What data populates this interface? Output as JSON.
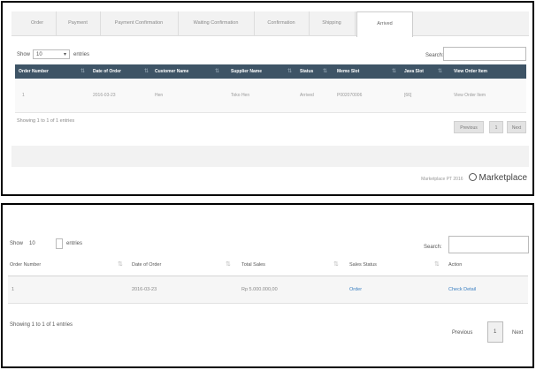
{
  "top_panel": {
    "tabs": [
      "Order",
      "Payment",
      "Payment Confirmation",
      "Waiting Confirmation",
      "Confirmation",
      "Shipping",
      "Arrived"
    ],
    "active_tab": "Arrived",
    "show_label": "Show",
    "entries_value": "10",
    "entries_label": "entries",
    "search_label": "Search:",
    "columns": [
      "Order Number",
      "Date of Order",
      "Customer Name",
      "Supplier Name",
      "Status",
      "Memo Slot",
      "Java Slot",
      "View Order Item"
    ],
    "row": [
      "1",
      "2016-03-23",
      "Hen",
      "Toko Hen",
      "Arrived",
      "P002070006",
      "[66]",
      "View Order Item"
    ],
    "info": "Showing 1 to 1 of 1 entries",
    "pagination": {
      "previous": "Previous",
      "page": "1",
      "next": "Next"
    },
    "footer_small": "Marketplace PT 2016",
    "brand": "Marketplace"
  },
  "bottom_panel": {
    "show_label": "Show",
    "entries_value": "10",
    "entries_label": "entries",
    "search_label": "Search:",
    "columns": [
      "Order Number",
      "Date of Order",
      "Total Sales",
      "Sales Status",
      "Action"
    ],
    "row": {
      "order_number": "1",
      "date": "2016-03-23",
      "total": "Rp 5.000.000,00",
      "status": "Order",
      "action": "Check Detail"
    },
    "info": "Showing 1 to 1 of 1 entries",
    "pagination": {
      "previous": "Previous",
      "page": "1",
      "next": "Next"
    }
  },
  "colors": {
    "header_bg": "#3e5466",
    "link": "#3a7fc1",
    "panel_bg": "#f2f2f2"
  }
}
